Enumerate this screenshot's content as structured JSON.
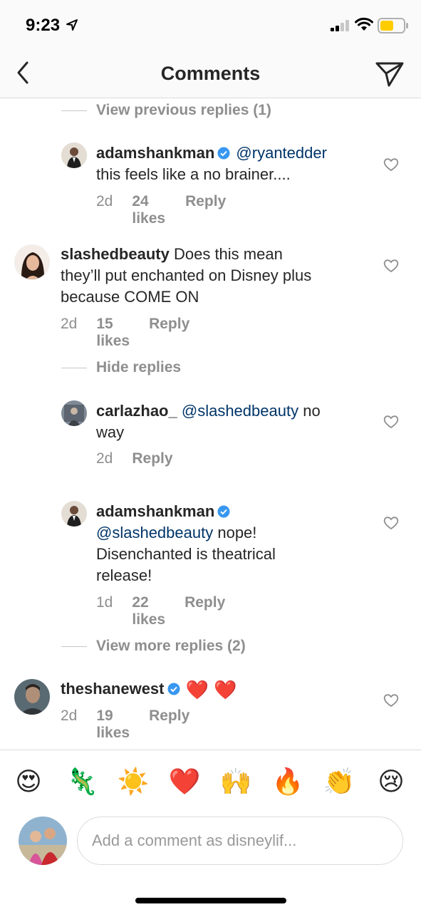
{
  "status_bar": {
    "time": "9:23"
  },
  "nav": {
    "title": "Comments",
    "back_icon": "chevron-left-icon",
    "send_icon": "paper-plane-icon"
  },
  "thread": {
    "view_previous_replies": "View previous replies (1)",
    "hide_replies": "Hide replies",
    "view_more_replies": "View more replies (2)"
  },
  "comments": [
    {
      "username": "adamshankman",
      "verified": true,
      "mention": "@ryantedder",
      "text_line1": "",
      "text_line2": "this feels like a no brainer....",
      "age": "2d",
      "likes": "24 likes",
      "reply": "Reply",
      "level": "reply"
    },
    {
      "username": "slashedbeauty",
      "verified": false,
      "text_line1": "Does this mean",
      "text_line2": "they’ll put enchanted on Disney plus",
      "text_line3": "because COME ON",
      "age": "2d",
      "likes": "15 likes",
      "reply": "Reply",
      "level": "top"
    },
    {
      "username": "carlazhao_",
      "verified": false,
      "mention": "@slashedbeauty",
      "text_line1": "no",
      "text_line2": "way",
      "age": "2d",
      "reply": "Reply",
      "level": "reply"
    },
    {
      "username": "adamshankman",
      "verified": true,
      "mention": "@slashedbeauty",
      "text_line1": "nope!",
      "text_line2": "Disenchanted is theatrical",
      "text_line3": "release!",
      "age": "1d",
      "likes": "22 likes",
      "reply": "Reply",
      "level": "reply"
    },
    {
      "username": "theshanewest",
      "verified": true,
      "emojis": "❤️ ❤️",
      "age": "2d",
      "likes": "19 likes",
      "reply": "Reply",
      "level": "top"
    }
  ],
  "emoji_bar": [
    "😍",
    "🦎",
    "☀️",
    "❤️",
    "🙌",
    "🔥",
    "👏",
    "😢"
  ],
  "composer": {
    "placeholder": "Add a comment as disneylif..."
  },
  "colors": {
    "verified_blue": "#3897f0",
    "mention_blue": "#003569",
    "heart_red": "#ed2939",
    "meta_gray": "#8e8e8e"
  }
}
